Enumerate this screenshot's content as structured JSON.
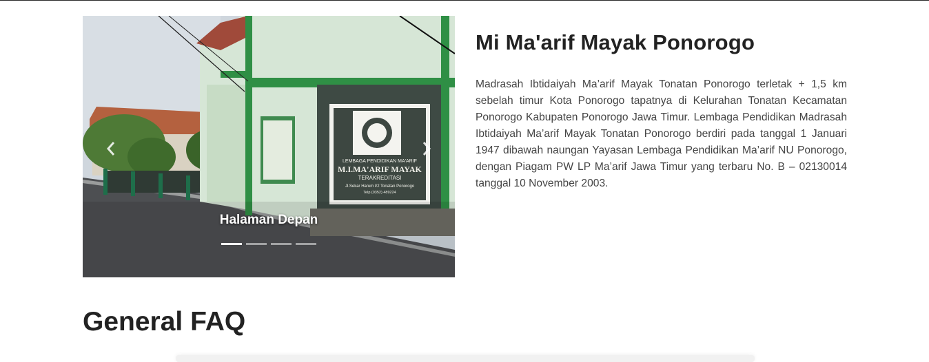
{
  "carousel": {
    "caption": "Halaman Depan",
    "slide_count": 4,
    "active_index": 0,
    "sign_lines": [
      "LEMBAGA PENDIDIKAN MA'ARIF",
      "M.I.MA'ARIF MAYAK",
      "TERAKREDITASI",
      "Jl.Sekar Harum I/2 Tonatan Ponorogo",
      "Telp (0352) 489224"
    ]
  },
  "about": {
    "title": "Mi Ma'arif Mayak Ponorogo",
    "description": "Madrasah Ibtidaiyah Ma’arif Mayak Tonatan Ponorogo terletak + 1,5 km sebelah timur Kota Ponorogo tapatnya di Kelurahan Tonatan Kecamatan Ponorogo Kabupaten Ponorogo Jawa Timur. Lembaga Pendidikan Madrasah Ibtidaiyah Ma’arif Mayak Tonatan Ponorogo berdiri pada tanggal 1 Januari 1947 dibawah naungan Yayasan Lembaga Pendidikan Ma’arif NU Ponorogo, dengan Piagam PW LP Ma’arif Jawa Timur yang terbaru No. B – 02130014 tanggal 10 November 2003."
  },
  "faq": {
    "title": "General FAQ"
  },
  "icons": {
    "prev": "chevron-left-icon",
    "next": "chevron-right-icon"
  }
}
